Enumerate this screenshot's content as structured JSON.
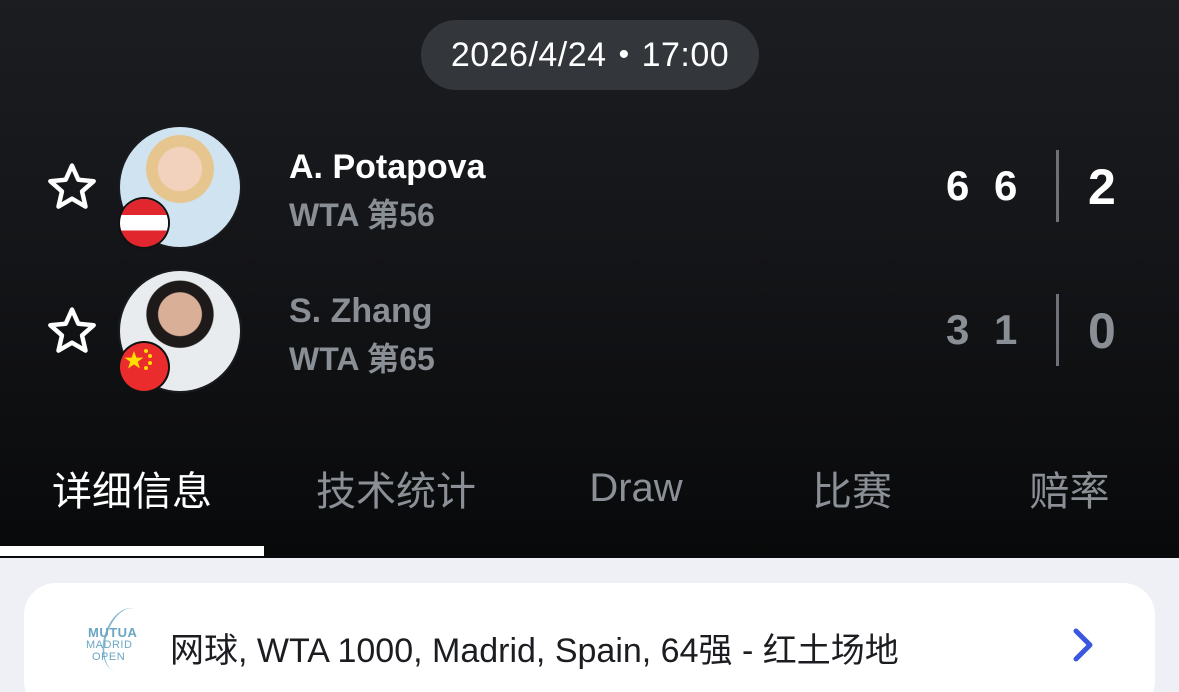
{
  "match": {
    "datetime": "2026/4/24",
    "separator": "•",
    "time": "17:00"
  },
  "players": [
    {
      "name": "A. Potapova",
      "rank": "WTA 第56",
      "set_scores": [
        "6",
        "6"
      ],
      "sets_won": "2",
      "flag": "austria-flag",
      "winner": true
    },
    {
      "name": "S. Zhang",
      "rank": "WTA 第65",
      "set_scores": [
        "3",
        "1"
      ],
      "sets_won": "0",
      "flag": "china-flag",
      "winner": false
    }
  ],
  "tabs": [
    {
      "label": "详细信息",
      "active": true
    },
    {
      "label": "技术统计",
      "active": false
    },
    {
      "label": "Draw",
      "active": false
    },
    {
      "label": "比赛",
      "active": false
    },
    {
      "label": "赔率",
      "active": false
    }
  ],
  "tournament": {
    "logo_line1": "MUTUA",
    "logo_line2": "MADRID",
    "logo_line3": "OPEN",
    "title": "网球, WTA 1000, Madrid, Spain, 64强 - 红土场地"
  },
  "colors": {
    "header_bg": "#141518",
    "muted_text": "#8a8e95",
    "accent_blue": "#3b57e0",
    "page_bg": "#eef0f5"
  },
  "icons": {
    "favorite": "star-outline-icon",
    "tournament_link": "chevron-right-icon"
  }
}
